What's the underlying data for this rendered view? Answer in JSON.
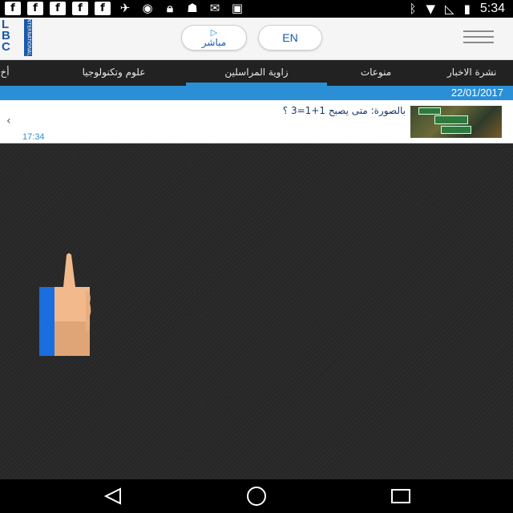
{
  "status_bar": {
    "time": "5:34",
    "left_icons": [
      "facebook-icon",
      "facebook-icon",
      "facebook-icon",
      "facebook-icon",
      "facebook-icon",
      "satellite-icon",
      "circle-icon",
      "lock-icon",
      "android-icon",
      "mail-icon",
      "briefcase-icon"
    ],
    "right_icons": [
      "bluetooth-icon",
      "wifi-icon",
      "no-signal-icon",
      "battery-icon"
    ]
  },
  "header": {
    "logo_text": "LBC",
    "logo_sub": "INTERNATIONAL",
    "live_label": "مباشر",
    "lang_label": "EN"
  },
  "tabs": [
    {
      "label": "أخ",
      "active": false
    },
    {
      "label": "علوم وتكنولوجيا",
      "active": false
    },
    {
      "label": "زاوية المراسلين",
      "active": true
    },
    {
      "label": "منوعات",
      "active": false
    },
    {
      "label": "نشرة الاخبار",
      "active": false
    }
  ],
  "date_bar": {
    "date": "22/01/2017"
  },
  "news_items": [
    {
      "title": "بالصورة: متى يصبح 1+1=3 ؟",
      "time": "17:34",
      "chevron": "‹"
    }
  ],
  "colors": {
    "accent": "#2b8fd6",
    "brand": "#1a5aa8",
    "tab_bg": "#222222",
    "body_bg": "#2a2a2a"
  }
}
